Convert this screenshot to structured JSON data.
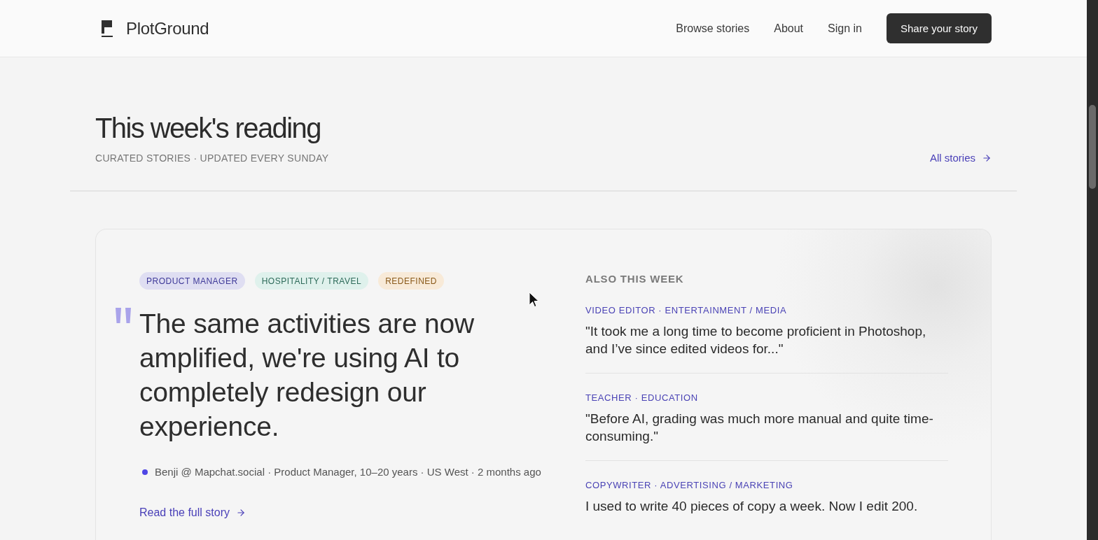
{
  "header": {
    "logo": "PlotGround",
    "nav": [
      "Browse stories",
      "About",
      "Sign in"
    ],
    "cta": "Share your story"
  },
  "section": {
    "title": "This week's reading",
    "subtitle": "CURATED STORIES · UPDATED EVERY SUNDAY",
    "link": "All stories"
  },
  "featured": {
    "tags": [
      {
        "label": "PRODUCT MANAGER",
        "color": "#3f3a99"
      },
      {
        "label": "HOSPITALITY / TRAVEL",
        "color": "#2e6b5a"
      },
      {
        "label": "REDEFINED",
        "color": "#8a5a1a"
      }
    ],
    "quote": "The same activities are now amplified, we're using AI to completely redesign our experience.",
    "byline": "Benji @ Mapchat.social · Product Manager, 10–20 years · US West · 2 months ago",
    "link": "Read the full story"
  },
  "also": {
    "heading": "ALSO THIS WEEK",
    "stories": [
      {
        "meta": "VIDEO EDITOR · ENTERTAINMENT / MEDIA",
        "quote": "\"It took me a long time to become proficient in Photoshop, and I’ve since edited videos for...\""
      },
      {
        "meta": "TEACHER · EDUCATION",
        "quote": "\"Before AI, grading was much more manual and quite time-consuming.\""
      },
      {
        "meta": "COPYWRITER · ADVERTISING / MARKETING",
        "quote": "I used to write 40 pieces of copy a week. Now I edit 200."
      }
    ]
  }
}
